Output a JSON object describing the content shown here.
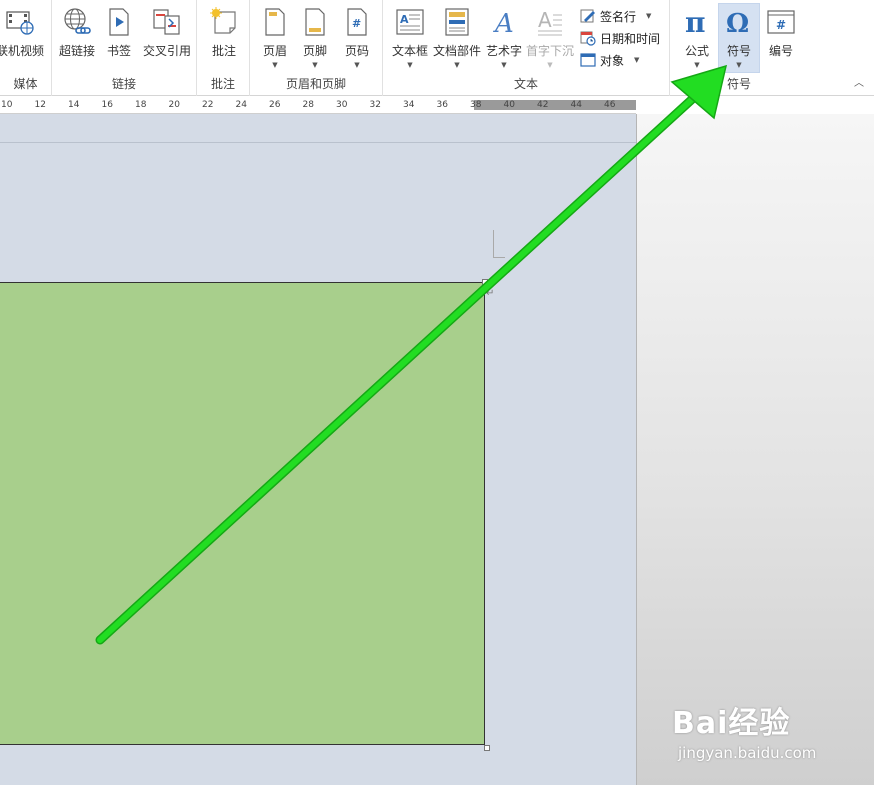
{
  "ribbon": {
    "media": {
      "group_label": "媒体",
      "online_video": "联机视频"
    },
    "links": {
      "group_label": "链接",
      "hyperlink": "超链接",
      "bookmark": "书签",
      "cross_reference": "交叉引用"
    },
    "comments": {
      "group_label": "批注",
      "comment": "批注"
    },
    "header_footer": {
      "group_label": "页眉和页脚",
      "header": "页眉",
      "footer": "页脚",
      "page_number": "页码"
    },
    "text": {
      "group_label": "文本",
      "text_box": "文本框",
      "quick_parts": "文档部件",
      "wordart": "艺术字",
      "drop_cap": "首字下沉",
      "signature_line": "签名行",
      "date_time": "日期和时间",
      "object": "对象"
    },
    "symbols": {
      "group_label": "符号",
      "equation": "公式",
      "symbol": "符号",
      "number": "编号"
    }
  },
  "ruler": {
    "ticks": [
      "10",
      "12",
      "14",
      "16",
      "18",
      "20",
      "22",
      "24",
      "26",
      "28",
      "30",
      "32",
      "34",
      "36",
      "38",
      "40",
      "42",
      "44",
      "46"
    ]
  },
  "watermark": {
    "logo": "Bai经验",
    "url": "jingyan.baidu.com"
  },
  "colors": {
    "accent_blue": "#2e6cb5",
    "highlight_arrow": "#22dd22",
    "shape_fill": "#a8cf8c"
  }
}
